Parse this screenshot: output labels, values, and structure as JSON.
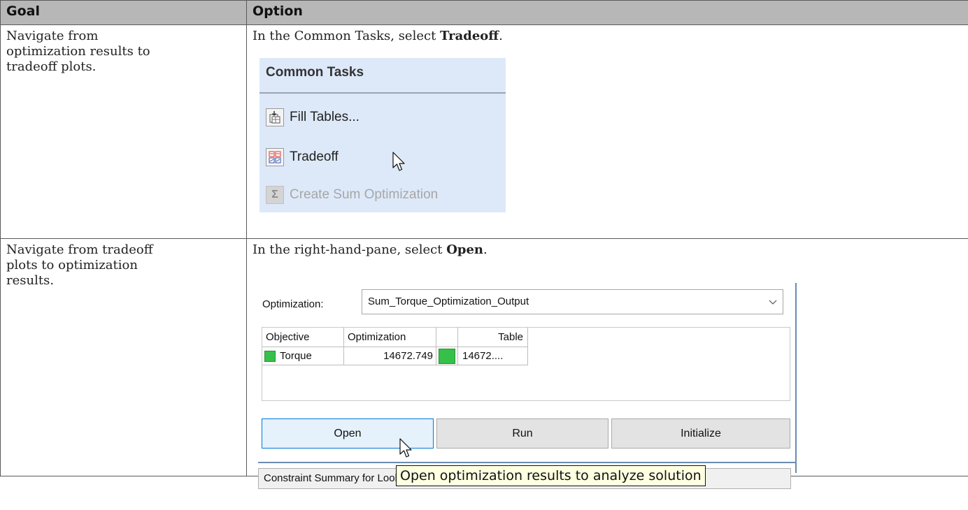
{
  "table": {
    "headers": {
      "goal": "Goal",
      "option": "Option"
    },
    "rows": [
      {
        "goal": "Navigate from optimization results to tradeoff plots.",
        "instruction_prefix": "In the Common Tasks, select ",
        "instruction_bold": "Tradeoff",
        "instruction_suffix": "."
      },
      {
        "goal": "Navigate from tradeoff plots to optimization results.",
        "instruction_prefix": "In the right-hand-pane, select ",
        "instruction_bold": "Open",
        "instruction_suffix": "."
      }
    ]
  },
  "common_tasks": {
    "title": "Common Tasks",
    "items": [
      {
        "label": "Fill Tables...",
        "icon": "fill-tables-icon",
        "enabled": true
      },
      {
        "label": "Tradeoff",
        "icon": "tradeoff-icon",
        "enabled": true
      },
      {
        "label": "Create Sum Optimization",
        "icon": "sigma-icon",
        "enabled": false
      }
    ]
  },
  "optimization_pane": {
    "optimization_label": "Optimization:",
    "optimization_value": "Sum_Torque_Optimization_Output",
    "columns": [
      "Objective",
      "Optimization",
      "",
      "Table"
    ],
    "row": {
      "objective": "Torque",
      "optimization": "14672.749",
      "table": "14672...."
    },
    "buttons": {
      "open": "Open",
      "run": "Run",
      "initialize": "Initialize"
    },
    "constraint_summary": "Constraint Summary for Lookup Tables",
    "tooltip": "Open optimization results to analyze solution"
  },
  "colors": {
    "header_bg": "#b7b7b7",
    "panel_bg": "#dde9f9",
    "status_green": "#35c04a",
    "tooltip_bg": "#ffffe1"
  }
}
